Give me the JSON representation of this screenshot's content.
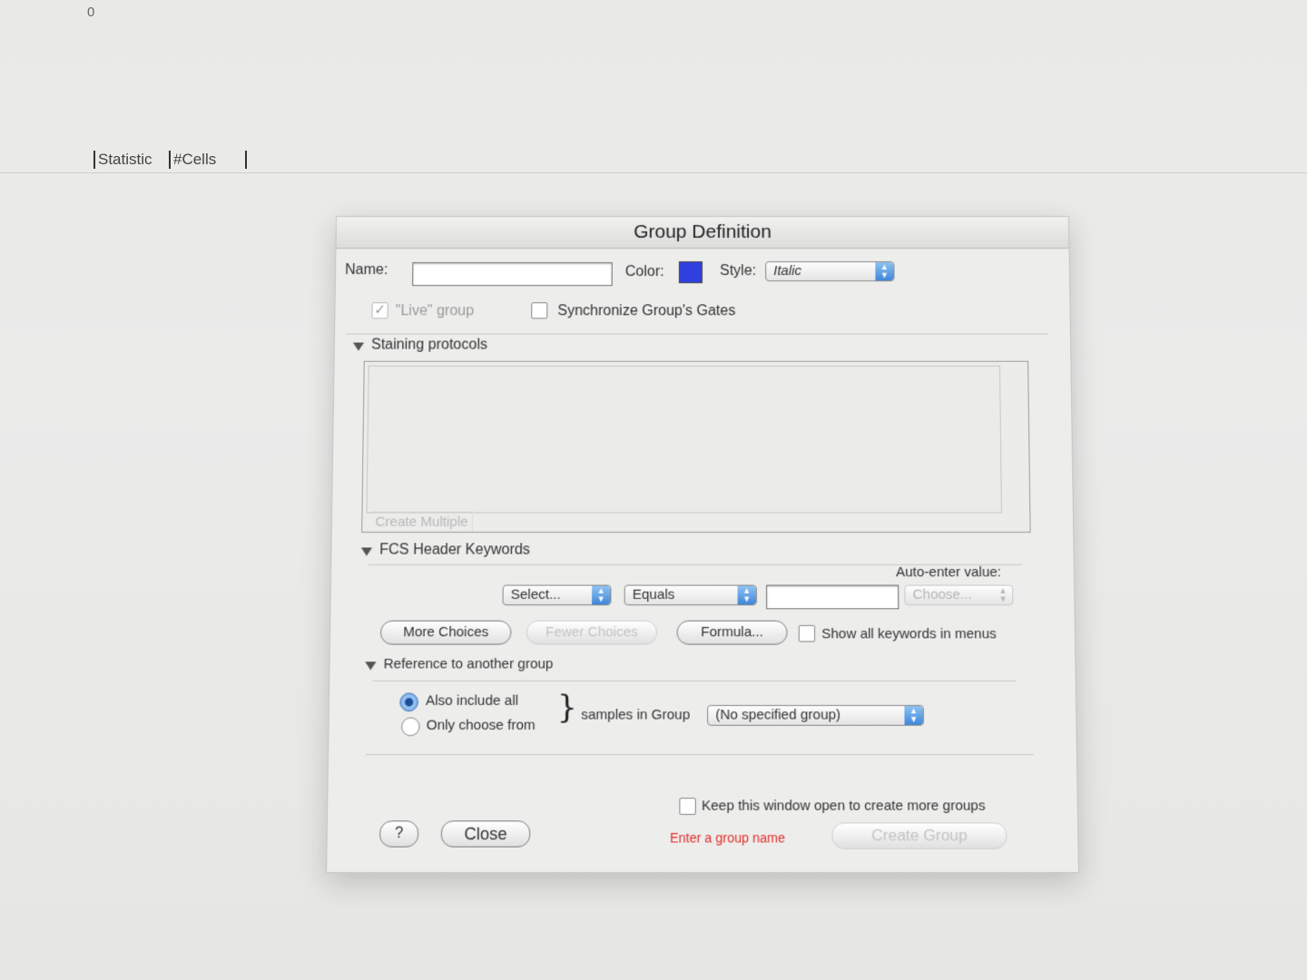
{
  "background": {
    "top_value": "0",
    "columns": [
      "Statistic",
      "#Cells"
    ]
  },
  "dialog": {
    "title": "Group Definition",
    "name_label": "Name:",
    "name_value": "",
    "color_label": "Color:",
    "color_value": "#2f3fe0",
    "style_label": "Style:",
    "style_value": "Italic",
    "live_group_label": "\"Live\" group",
    "sync_gates_label": "Synchronize Group's Gates",
    "staining": {
      "title": "Staining protocols",
      "create_multiple": "Create Multiple"
    },
    "fcs": {
      "title": "FCS Header Keywords",
      "auto_enter_label": "Auto-enter value:",
      "select_value": "Select...",
      "operator_value": "Equals",
      "value_input": "",
      "choose_value": "Choose...",
      "more_choices": "More Choices",
      "fewer_choices": "Fewer Choices",
      "formula": "Formula...",
      "show_all_keywords": "Show all keywords in menus"
    },
    "reference": {
      "title": "Reference to another group",
      "option_include": "Also include all",
      "option_only": "Only choose from",
      "brace": "}",
      "samples_label": "samples in Group",
      "group_value": "(No specified group)"
    },
    "footer": {
      "help": "?",
      "close": "Close",
      "keep_open": "Keep this window open to create more groups",
      "error_msg": "Enter a group name",
      "create_group": "Create Group"
    }
  }
}
